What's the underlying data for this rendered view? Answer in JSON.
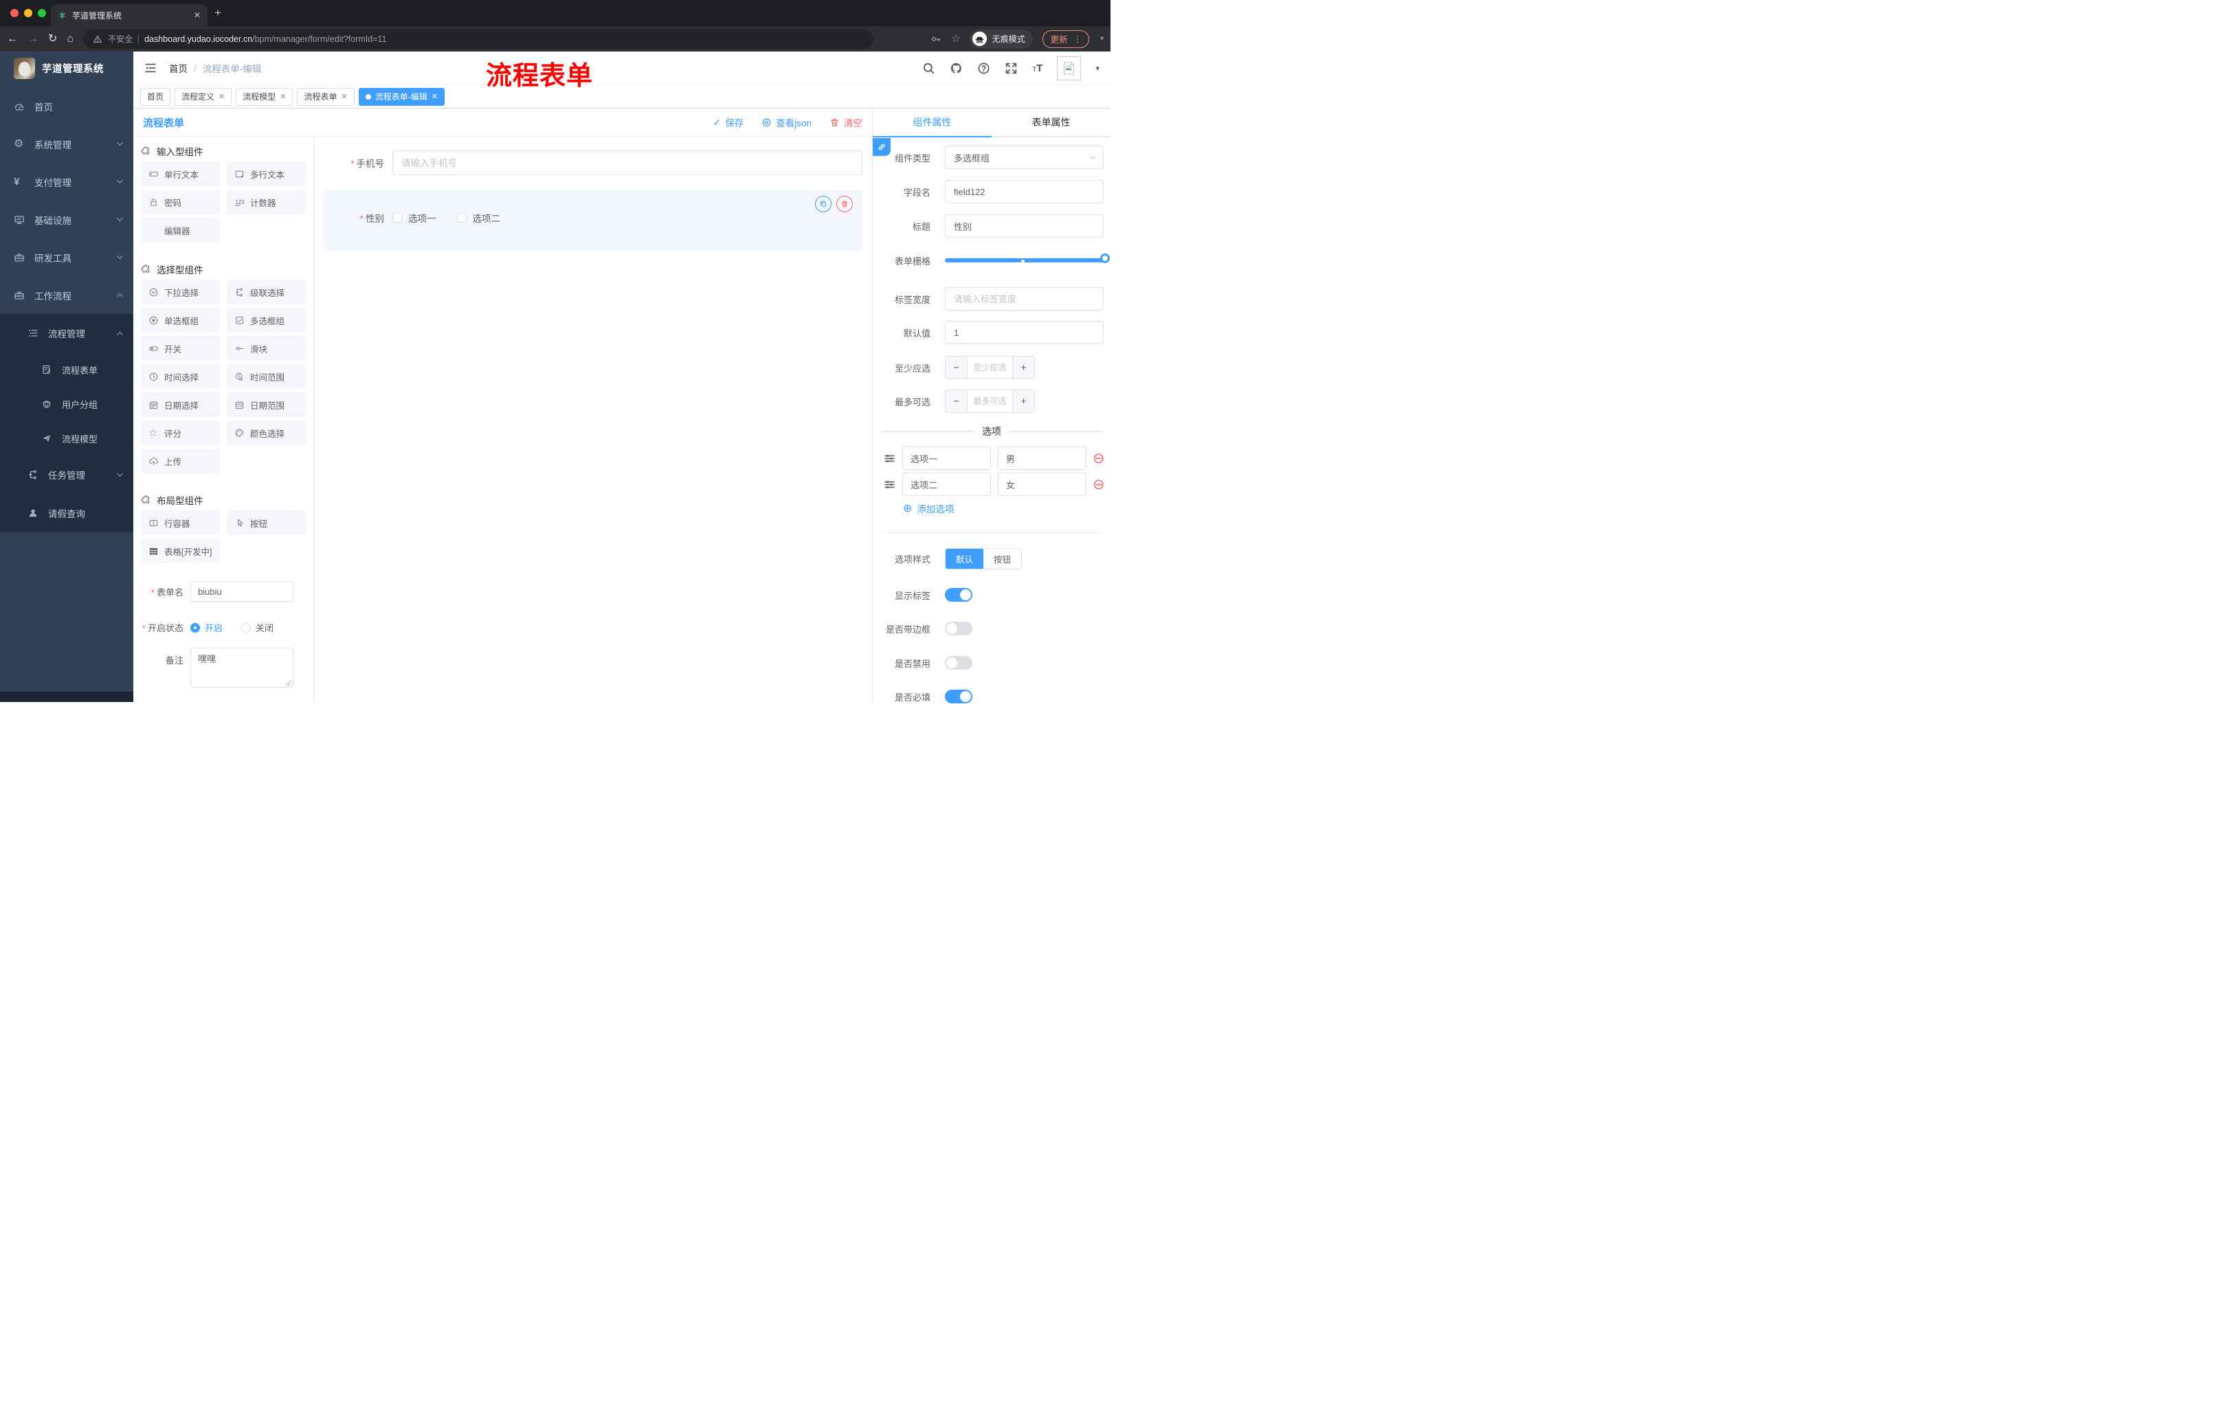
{
  "colors": {
    "accent": "#409eff",
    "danger": "#f56c6c",
    "watermark": "#fe0000",
    "side": "#304156",
    "sub": "#1f2d3d"
  },
  "browser": {
    "tab_title": "芋道管理系统",
    "close_glyph": "✕",
    "new_tab_glyph": "+",
    "security_label": "不安全",
    "url_host": "dashboard.yudao.iocoder.cn",
    "url_path": "/bpm/manager/form/edit?formId=11",
    "incognito_label": "无痕模式",
    "update_label": "更新"
  },
  "watermark": "流程表单",
  "sidebar": {
    "logo_title": "芋道管理系统",
    "items": [
      {
        "label": "首页"
      },
      {
        "label": "系统管理"
      },
      {
        "label": "支付管理"
      },
      {
        "label": "基础设施"
      },
      {
        "label": "研发工具"
      },
      {
        "label": "工作流程"
      },
      {
        "label": "流程管理"
      },
      {
        "label": "流程表单"
      },
      {
        "label": "用户分组"
      },
      {
        "label": "流程模型"
      },
      {
        "label": "任务管理"
      },
      {
        "label": "请假查询"
      }
    ]
  },
  "header": {
    "breadcrumb_home": "首页",
    "breadcrumb_sep": "/",
    "breadcrumb_current": "流程表单-编辑"
  },
  "nav_tabs": [
    {
      "label": "首页"
    },
    {
      "label": "流程定义"
    },
    {
      "label": "流程模型"
    },
    {
      "label": "流程表单"
    },
    {
      "label": "流程表单-编辑"
    }
  ],
  "toolbar": {
    "title": "流程表单",
    "save": "保存",
    "view_json": "查看json",
    "clear": "清空"
  },
  "panel": {
    "section_input": "输入型组件",
    "section_select": "选择型组件",
    "section_layout": "布局型组件",
    "input_items": [
      "单行文本",
      "多行文本",
      "密码",
      "计数器",
      "编辑器"
    ],
    "select_items": [
      "下拉选择",
      "级联选择",
      "单选框组",
      "多选框组",
      "开关",
      "滑块",
      "时间选择",
      "时间范围",
      "日期选择",
      "日期范围",
      "评分",
      "颜色选择",
      "上传"
    ],
    "layout_items": [
      "行容器",
      "按钮",
      "表格[开发中]"
    ],
    "form": {
      "name_label": "表单名",
      "name_value": "biubiu",
      "status_label": "开启状态",
      "status_on": "开启",
      "status_off": "关闭",
      "remark_label": "备注",
      "remark_value": "嘿嘿"
    }
  },
  "canvas": {
    "phone_label": "手机号",
    "phone_placeholder": "请输入手机号",
    "gender_label": "性别",
    "gender_opt1": "选项一",
    "gender_opt2": "选项二"
  },
  "props": {
    "tab_component": "组件属性",
    "tab_form": "表单属性",
    "type_label": "组件类型",
    "type_value": "多选框组",
    "field_label": "字段名",
    "field_value": "field122",
    "title_label": "标题",
    "title_value": "性别",
    "grid_label": "表单栅格",
    "label_width_label": "标签宽度",
    "label_width_placeholder": "请输入标签宽度",
    "default_label": "默认值",
    "default_value": "1",
    "min_label": "至少应选",
    "min_placeholder": "至少应选",
    "max_label": "最多可选",
    "max_placeholder": "最多可选",
    "options_divider": "选项",
    "options": [
      {
        "label": "选项一",
        "value": "男"
      },
      {
        "label": "选项二",
        "value": "女"
      }
    ],
    "add_option": "添加选项",
    "style_label": "选项样式",
    "style_default": "默认",
    "style_button": "按钮",
    "show_label": "显示标签",
    "border_label": "是否带边框",
    "disabled_label": "是否禁用",
    "required_label": "是否必填"
  }
}
